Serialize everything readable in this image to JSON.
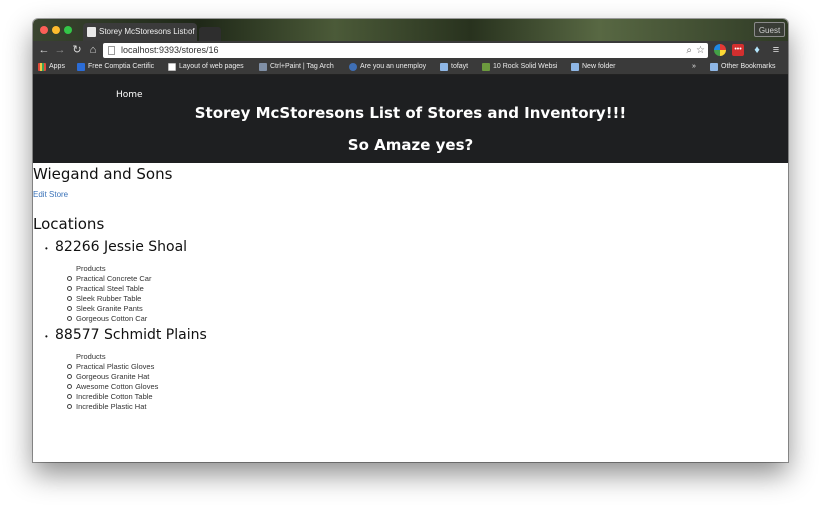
{
  "browser": {
    "tab_title": "Storey McStoresons List of",
    "url": "localhost:9393/stores/16",
    "guest_label": "Guest",
    "bookmarks": [
      {
        "label": "Apps",
        "icon": "apps-grid-icon",
        "color": "#e04b3a"
      },
      {
        "label": "Free Comptia Certific",
        "icon": "p-logo-icon",
        "color": "#2b6cd6"
      },
      {
        "label": "Layout of web pages",
        "icon": "page-icon",
        "color": "#bdbdbd"
      },
      {
        "label": "Ctrl+Paint | Tag Arch",
        "icon": "ctrlpaint-icon",
        "color": "#7f8fa6"
      },
      {
        "label": "Are you an unemploy",
        "icon": "circle-logo-icon",
        "color": "#3f6fb5"
      },
      {
        "label": "tofayt",
        "icon": "folder-icon",
        "color": "#8fb7e6"
      },
      {
        "label": "10 Rock Solid Websi",
        "icon": "d-logo-icon",
        "color": "#6c9a3e"
      },
      {
        "label": "New folder",
        "icon": "folder-icon",
        "color": "#8fb7e6"
      }
    ],
    "more_bookmarks": "»",
    "other_bookmarks": "Other Bookmarks"
  },
  "page": {
    "nav_home": "Home",
    "title": "Storey McStoresons List of Stores and Inventory!!!",
    "subtitle": "So Amaze yes?",
    "store_name": "Wiegand and Sons",
    "edit_link": "Edit Store",
    "locations_heading": "Locations",
    "locations": [
      {
        "name": "82266 Jessie Shoal",
        "products_label": "Products",
        "products": [
          "Practical Concrete Car",
          "Practical Steel Table",
          "Sleek Rubber Table",
          "Sleek Granite Pants",
          "Gorgeous Cotton Car"
        ]
      },
      {
        "name": "88577 Schmidt Plains",
        "products_label": "Products",
        "products": [
          "Practical Plastic Gloves",
          "Gorgeous Granite Hat",
          "Awesome Cotton Gloves",
          "Incredible Cotton Table",
          "Incredible Plastic Hat"
        ]
      }
    ]
  },
  "colors": {
    "header_bg": "#1e1f21",
    "link": "#3b73b9"
  }
}
